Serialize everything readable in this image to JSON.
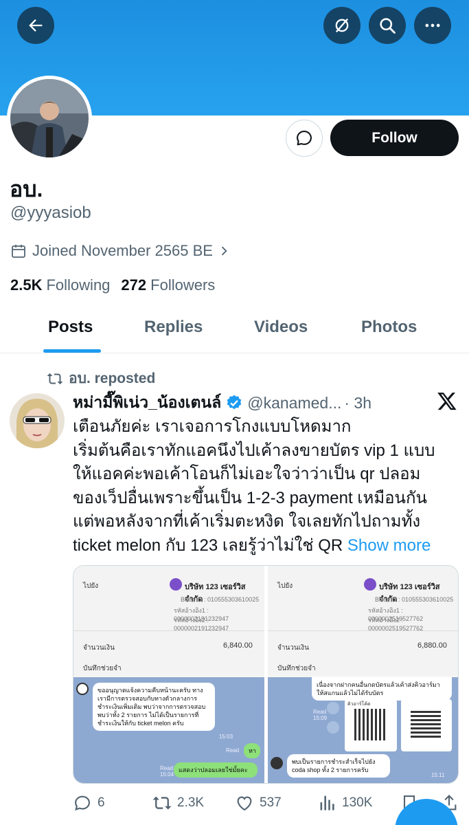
{
  "header": {
    "back_icon": "arrow-left-icon",
    "grok_icon": "grok-icon",
    "search_icon": "search-icon",
    "more_icon": "more-horizontal-icon",
    "banner_color": "#1d9bf0"
  },
  "profile": {
    "display_name": "อบ.",
    "handle": "@yyyasiob",
    "joined": "Joined November 2565 BE",
    "following_count": "2.5K",
    "following_label": "Following",
    "followers_count": "272",
    "followers_label": "Followers",
    "follow_label": "Follow",
    "message_icon": "message-icon"
  },
  "tabs": [
    {
      "label": "Posts",
      "active": true
    },
    {
      "label": "Replies",
      "active": false
    },
    {
      "label": "Videos",
      "active": false
    },
    {
      "label": "Photos",
      "active": false
    }
  ],
  "post": {
    "repost_label": "อบ. reposted",
    "author_name": "หม่ามี๊พิเน่ว_น้องเตนล์",
    "author_handle": "@kanamed...",
    "time": "· 3h",
    "verified": true,
    "text_lines": [
      "เตือนภัยค่ะ เราเจอการโกงแบบโหดมาก",
      "เริ่มต้นคือเราทักแอคนึงไปเค้าลงขายบัตร vip 1 แบบ",
      "ให้แอคค่ะพอเค้าโอนก็ไม่เอะใจว่าว่าเป็น qr ปลอม",
      "ของเว็ปอื่นเพราะขึ้นเป็น 1-2-3 payment เหมือนกัน",
      "แต่พอหลังจากที่เค้าเริ่มตะหงิด ใจเลยทักไปถามทั้ง",
      "ticket melon กับ 123 เลยรู้ว่าไม่ใช่ QR"
    ],
    "show_more": "Show more",
    "media": {
      "left": {
        "to_label": "ไปยัง",
        "company": "บริษัท 123 เซอร์วิส จำกัด",
        "biller_id": "Biller ID : 010555303610025",
        "ref1": "รหัสอ้างอิง1 : 0000002191232947",
        "ref2": "รหัสอ้างอิง2 : 0000002191232947",
        "amount_label": "จำนวนเงิน",
        "amount": "6,840.00",
        "memo_label": "บันทึกช่วยจำ",
        "chat_bubble_1": "ขออนุญาตแจ้งความคืบหน้านะครับ ทางเรามีการตรวจสอบกับทางตัวกลางการชำระเงินเพิ่มเติม พบว่าจากการตรวจสอบพบว่าทั้ง 2 รายการ ไม่ได้เป็นรายการที่ชำระเงินให้กับ ticket melon ครับ",
        "time_1": "15:03",
        "read_1": "Read",
        "reply_1": "หา",
        "read_2": "Read",
        "time_2": "15:04",
        "reply_2": "แสดงว่าปลอมเลยใช่มั้ยคะ"
      },
      "right": {
        "to_label": "ไปยัง",
        "company": "บริษัท 123 เซอร์วิส จำกัด",
        "biller_id": "Biller ID : 010555303610025",
        "ref1": "รหัสอ้างอิง1 : 0000002519527762",
        "ref2": "รหัสอ้างอิง2 : 0000002519527762",
        "amount_label": "จำนวนเงิน",
        "amount": "6,880.00",
        "memo_label": "บันทึกช่วยจำ",
        "chat_top": "เนื่องจากฝากคนอื่นกดบัตรแล้วเค้าส่งคิวอาร์มาให้สแกนแล้วไม่ได้รับบัตร",
        "read_1": "Read",
        "time_1": "15:09",
        "qr_title": "คิวอาร์โค้ด",
        "chat_bottom": "พบเป็นรายการชำระสำเร็จไปยัง coda shop ทั้ง 2 รายการครับ",
        "time_2": "15:11"
      }
    },
    "actions": {
      "replies": "6",
      "reposts": "2.3K",
      "likes": "537",
      "views": "130K"
    }
  }
}
